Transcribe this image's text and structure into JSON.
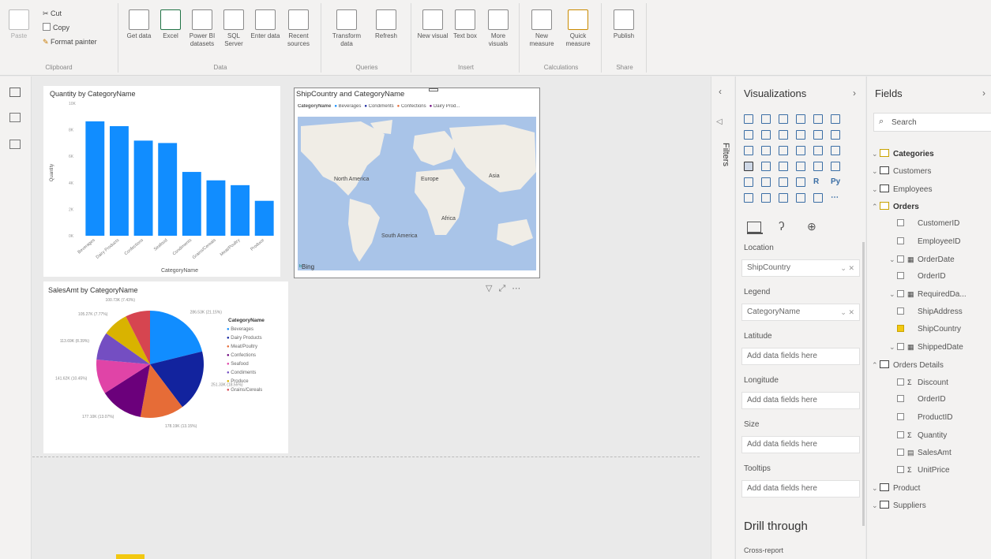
{
  "ribbon": {
    "clipboard": {
      "paste": "Paste",
      "cut": "Cut",
      "copy": "Copy",
      "format_painter": "Format painter",
      "group": "Clipboard"
    },
    "data": {
      "get_data": "Get data",
      "excel": "Excel",
      "power_bi": "Power BI datasets",
      "sql": "SQL Server",
      "enter": "Enter data",
      "recent": "Recent sources",
      "group": "Data"
    },
    "queries": {
      "transform": "Transform data",
      "refresh": "Refresh",
      "group": "Queries"
    },
    "insert": {
      "new_visual": "New visual",
      "text_box": "Text box",
      "more_visuals": "More visuals",
      "group": "Insert"
    },
    "calculations": {
      "new_measure": "New measure",
      "quick_measure": "Quick measure",
      "group": "Calculations"
    },
    "share": {
      "publish": "Publish",
      "group": "Share"
    }
  },
  "bar_chart": {
    "title": "Quantity by CategoryName",
    "xlabel": "CategoryName",
    "ylabel": "Quantity",
    "color": "#118dff",
    "chart_data": {
      "type": "bar",
      "categories": [
        "Beverages",
        "Dairy Products",
        "Confections",
        "Seafood",
        "Condiments",
        "Grains/Cereals",
        "Meat/Poultry",
        "Produce"
      ],
      "values": [
        9500,
        9100,
        7900,
        7700,
        5300,
        4600,
        4200,
        2900
      ],
      "ylim": [
        0,
        11000
      ]
    },
    "yticks": [
      "10K",
      "8K",
      "6K",
      "4K",
      "2K",
      "0K"
    ]
  },
  "map": {
    "title": "ShipCountry and CategoryName",
    "legend_title": "CategoryName",
    "legend_items": [
      "Beverages",
      "Condiments",
      "Confections",
      "Dairy Prod..."
    ],
    "legend_colors": [
      "#118dff",
      "#12239e",
      "#e66c37",
      "#6b007b"
    ],
    "labels": [
      "North America",
      "Europe",
      "Asia",
      "Africa",
      "South America"
    ],
    "bing": "Bing"
  },
  "pie_chart": {
    "title": "SalesAmt by CategoryName",
    "legend_title": "CategoryName",
    "chart_data": {
      "type": "pie",
      "categories": [
        "Beverages",
        "Dairy Products",
        "Meat/Poultry",
        "Confections",
        "Seafood",
        "Condiments",
        "Produce",
        "Grains/Cereals"
      ],
      "values": [
        286526,
        251331,
        178188,
        177099,
        141623,
        113695,
        105268,
        100727
      ],
      "colors": [
        "#118dff",
        "#12239e",
        "#e66c37",
        "#6b007b",
        "#e044a7",
        "#744ec2",
        "#d9b300",
        "#d64550"
      ]
    },
    "data_labels": [
      "286.53K (21.15%)",
      "251.33K (18.55%)",
      "178.19K (13.15%)",
      "177.10K (13.07%)",
      "141.62K (10.45%)",
      "113.69K (8.39%)",
      "105.27K (7.77%)",
      "100.73K (7.43%)"
    ]
  },
  "filters_label": "Filters",
  "visualizations": {
    "title": "Visualizations",
    "wells": [
      {
        "label": "Location",
        "value": "ShipCountry"
      },
      {
        "label": "Legend",
        "value": "CategoryName"
      },
      {
        "label": "Latitude",
        "value": "Add data fields here"
      },
      {
        "label": "Longitude",
        "value": "Add data fields here"
      },
      {
        "label": "Size",
        "value": "Add data fields here"
      },
      {
        "label": "Tooltips",
        "value": "Add data fields here"
      }
    ],
    "drill_through": "Drill through",
    "cross_report": "Cross-report"
  },
  "fields": {
    "title": "Fields",
    "search_placeholder": "Search",
    "items": [
      {
        "label": "Categories",
        "kind": "table",
        "indent": 0,
        "bold": true
      },
      {
        "label": "Customers",
        "kind": "table",
        "indent": 0
      },
      {
        "label": "Employees",
        "kind": "table",
        "indent": 0
      },
      {
        "label": "Orders",
        "kind": "table",
        "indent": 0,
        "bold": true,
        "expanded": true
      },
      {
        "label": "CustomerID",
        "kind": "field",
        "indent": 1
      },
      {
        "label": "EmployeeID",
        "kind": "field",
        "indent": 1
      },
      {
        "label": "OrderDate",
        "kind": "date",
        "indent": 1
      },
      {
        "label": "OrderID",
        "kind": "field",
        "indent": 1
      },
      {
        "label": "RequiredDa...",
        "kind": "date",
        "indent": 1
      },
      {
        "label": "ShipAddress",
        "kind": "field",
        "indent": 1
      },
      {
        "label": "ShipCountry",
        "kind": "field",
        "indent": 1,
        "checked": true
      },
      {
        "label": "ShippedDate",
        "kind": "date",
        "indent": 1
      },
      {
        "label": "Orders Details",
        "kind": "table",
        "indent": 0,
        "expanded": true
      },
      {
        "label": "Discount",
        "kind": "sum",
        "indent": 1
      },
      {
        "label": "OrderID",
        "kind": "field",
        "indent": 1
      },
      {
        "label": "ProductID",
        "kind": "field",
        "indent": 1
      },
      {
        "label": "Quantity",
        "kind": "sum",
        "indent": 1
      },
      {
        "label": "SalesAmt",
        "kind": "measure",
        "indent": 1
      },
      {
        "label": "UnitPrice",
        "kind": "sum",
        "indent": 1
      },
      {
        "label": "Product",
        "kind": "table",
        "indent": 0
      },
      {
        "label": "Suppliers",
        "kind": "table",
        "indent": 0
      }
    ]
  }
}
